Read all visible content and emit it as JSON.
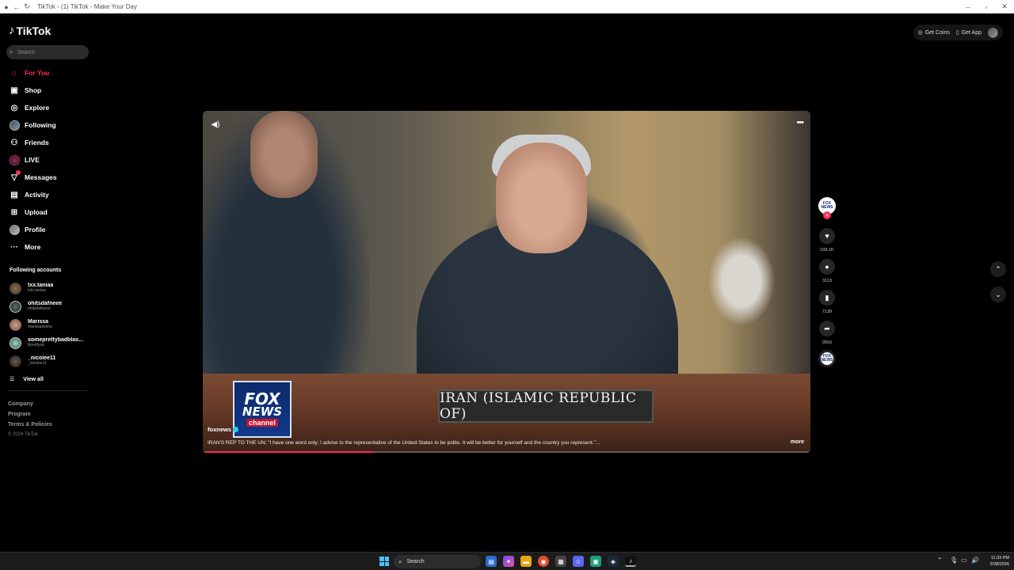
{
  "browser": {
    "title": "TikTok - (1) TikTok - Make Your Day"
  },
  "sidebar": {
    "logo": "TikTok",
    "search_placeholder": "Search",
    "nav": [
      {
        "label": "For You",
        "icon": "home-icon"
      },
      {
        "label": "Shop",
        "icon": "shop-icon"
      },
      {
        "label": "Explore",
        "icon": "compass-icon"
      },
      {
        "label": "Following",
        "icon": "avatar-icon"
      },
      {
        "label": "Friends",
        "icon": "friends-icon"
      },
      {
        "label": "LIVE",
        "icon": "live-icon"
      },
      {
        "label": "Messages",
        "icon": "messages-icon"
      },
      {
        "label": "Activity",
        "icon": "activity-icon"
      },
      {
        "label": "Upload",
        "icon": "upload-icon"
      },
      {
        "label": "Profile",
        "icon": "profile-icon"
      },
      {
        "label": "More",
        "icon": "more-icon"
      }
    ],
    "following_label": "Following accounts",
    "accounts": [
      {
        "name": "txx.taniaa",
        "handle": "txtx.taniaa"
      },
      {
        "name": "ohitsdafneee",
        "handle": "ohitsdafneee"
      },
      {
        "name": "Marissa",
        "handle": "marissaxloma"
      },
      {
        "name": "someprettybadblas...",
        "handle": "ilipretlysa"
      },
      {
        "name": "_nicolee11",
        "handle": "_nicolee11"
      }
    ],
    "view_all": "View all",
    "footer": [
      "Company",
      "Program",
      "Terms & Policies"
    ],
    "copyright": "© 2024 TikTok"
  },
  "topbar": {
    "get_coins": "Get Coins",
    "get_app": "Get App"
  },
  "video": {
    "author": "foxnews",
    "caption": "IRAN'S REP TO THE UN: \"I have one word only; I advise to the representative of the United States to be polite. It will be better for yourself and the country you represent.\"...",
    "more": "more",
    "nameplate": "IRAN (ISLAMIC REPUBLIC OF)",
    "logo_line1": "FOX",
    "logo_line2": "NEWS",
    "logo_line3": "channel",
    "progress": 0.28
  },
  "actions": {
    "avatar_text_1": "FOX",
    "avatar_text_2": "NEWS",
    "likes": "109.1K",
    "comments": "3113",
    "saves": "7139",
    "shares": "2816"
  },
  "taskbar": {
    "search": "Search",
    "time": "11:33 PM",
    "date": "2/28/2026"
  }
}
